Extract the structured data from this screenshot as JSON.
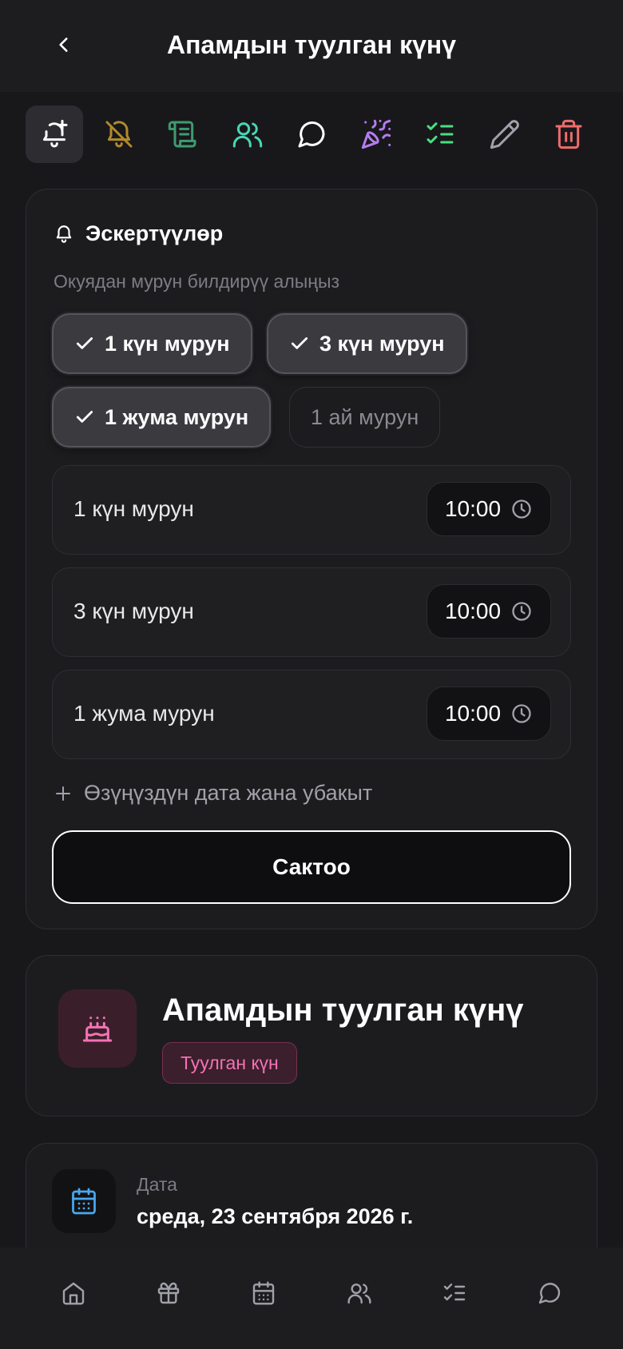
{
  "header": {
    "title": "Апамдын туулган күнү"
  },
  "toolbar": {
    "items": [
      {
        "name": "add-reminder",
        "icon": "bell-plus-icon",
        "color": "#ffffff",
        "active": true
      },
      {
        "name": "mute",
        "icon": "bell-off-icon",
        "color": "#b08a2e"
      },
      {
        "name": "notes",
        "icon": "scroll-icon",
        "color": "#3f9b6f"
      },
      {
        "name": "people",
        "icon": "users-icon",
        "color": "#49d6b4"
      },
      {
        "name": "chat",
        "icon": "message-circle-icon",
        "color": "#ffffff"
      },
      {
        "name": "celebrate",
        "icon": "party-popper-icon",
        "color": "#b57cf0"
      },
      {
        "name": "checklist",
        "icon": "list-checks-icon",
        "color": "#4ade80"
      },
      {
        "name": "edit",
        "icon": "pencil-icon",
        "color": "#a1a1aa"
      },
      {
        "name": "delete",
        "icon": "trash-icon",
        "color": "#f06b6b"
      }
    ]
  },
  "reminders": {
    "title": "Эскертүүлөр",
    "subtitle": "Окуядан мурун билдирүү алыңыз",
    "chips": [
      {
        "label": "1 күн мурун",
        "selected": true
      },
      {
        "label": "3 күн мурун",
        "selected": true
      },
      {
        "label": "1 жума мурун",
        "selected": true
      },
      {
        "label": "1 ай мурун",
        "selected": false
      }
    ],
    "times": [
      {
        "label": "1 күн мурун",
        "time": "10:00"
      },
      {
        "label": "3 күн мурун",
        "time": "10:00"
      },
      {
        "label": "1 жума мурун",
        "time": "10:00"
      }
    ],
    "custom_label": "Өзүңүздүн дата жана убакыт",
    "save_label": "Сактоо"
  },
  "event": {
    "title": "Апамдын туулган күнү",
    "badge": "Туулган күн",
    "accent": "#f472b6"
  },
  "date": {
    "label": "Дата",
    "value": "среда, 23 сентября 2026 г."
  },
  "bottom_nav": [
    "home-icon",
    "gift-icon",
    "calendar-icon",
    "users-icon",
    "list-checks-icon",
    "message-circle-icon"
  ]
}
